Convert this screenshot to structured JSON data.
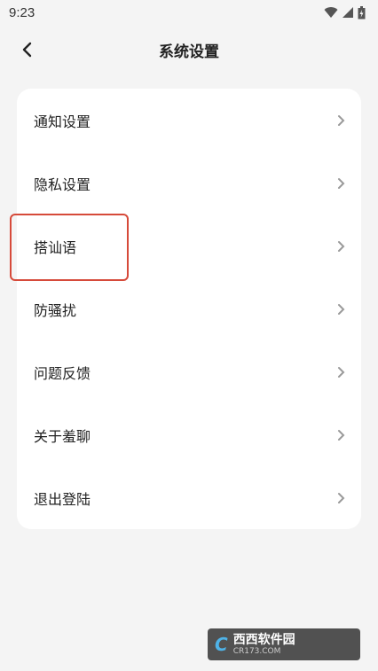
{
  "status_bar": {
    "time": "9:23",
    "icons": [
      "wifi-icon",
      "signal-icon",
      "battery-icon"
    ]
  },
  "header": {
    "title": "系统设置",
    "back_icon": "back-arrow-icon"
  },
  "menu": {
    "items": [
      {
        "label": "通知设置"
      },
      {
        "label": "隐私设置"
      },
      {
        "label": "搭讪语"
      },
      {
        "label": "防骚扰"
      },
      {
        "label": "问题反馈"
      },
      {
        "label": "关于羞聊"
      },
      {
        "label": "退出登陆"
      }
    ]
  },
  "highlight": {
    "color": "#d64a3a",
    "target": "搭讪语"
  },
  "watermark": {
    "logo": "C",
    "main": "西西软件园",
    "sub": "CR173.COM"
  },
  "colors": {
    "background": "#f4f4f4",
    "card": "#ffffff",
    "chevron": "#9a9a9a"
  }
}
